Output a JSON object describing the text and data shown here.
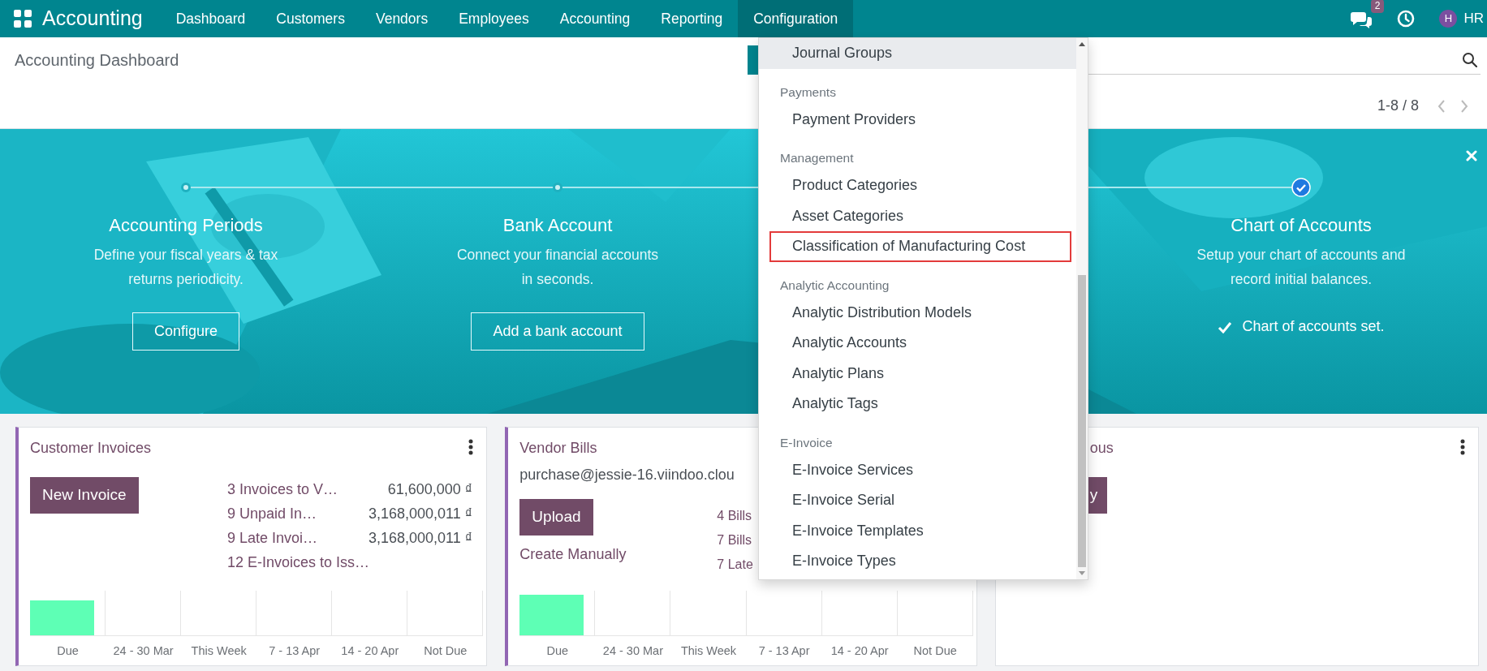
{
  "navbar": {
    "app_name": "Accounting",
    "menu": [
      {
        "label": "Dashboard",
        "selected": false
      },
      {
        "label": "Customers",
        "selected": false
      },
      {
        "label": "Vendors",
        "selected": false
      },
      {
        "label": "Employees",
        "selected": false
      },
      {
        "label": "Accounting",
        "selected": false
      },
      {
        "label": "Reporting",
        "selected": false
      },
      {
        "label": "Configuration",
        "selected": true
      }
    ],
    "messages_badge": "2",
    "avatar_initial": "H",
    "user": "HR"
  },
  "control_panel": {
    "breadcrumb": "Accounting Dashboard",
    "pager": "1-8 / 8"
  },
  "onboarding": {
    "steps": [
      {
        "title": "Accounting Periods",
        "description_lines": [
          "Define your fiscal years & tax",
          "returns periodicity."
        ],
        "done": false,
        "action": "Configure"
      },
      {
        "title": "Bank Account",
        "description_lines": [
          "Connect your financial accounts",
          "in seconds."
        ],
        "done": false,
        "action": "Add a bank account"
      },
      {
        "title": "Chart of Accounts",
        "description_lines": [
          "Setup your chart of accounts and",
          "record initial balances."
        ],
        "done": true,
        "action": "Chart of accounts set."
      }
    ]
  },
  "cards": [
    {
      "title": "Customer Invoices",
      "accent": true,
      "primary_action": "New Invoice",
      "stats": [
        {
          "label": "3 Invoices to V…",
          "amount": "61,600,000 ₫"
        },
        {
          "label": "9 Unpaid In…",
          "amount": "3,168,000,011 ₫"
        },
        {
          "label": "9 Late Invoi…",
          "amount": "3,168,000,011 ₫"
        },
        {
          "label": "12 E-Invoices to Iss…"
        }
      ],
      "chart": {
        "columns": [
          {
            "label": "Due",
            "filled": true
          },
          {
            "label": "24 - 30 Mar",
            "filled": false
          },
          {
            "label": "This Week",
            "filled": false
          },
          {
            "label": "7 - 13 Apr",
            "filled": false
          },
          {
            "label": "14 - 20 Apr",
            "filled": false
          },
          {
            "label": "Not Due",
            "filled": false
          }
        ]
      }
    },
    {
      "title": "Vendor Bills",
      "subtitle": "purchase@jessie-16.viindoo.clou",
      "accent": true,
      "primary_action": "Upload",
      "secondary_action": "Create Manually",
      "stats": [
        {
          "label": "4 Bills"
        },
        {
          "label": "7 Bills"
        },
        {
          "label": "7 Late"
        }
      ],
      "chart": {
        "columns": [
          {
            "label": "Due",
            "filled": true
          },
          {
            "label": "24 - 30 Mar",
            "filled": false
          },
          {
            "label": "This Week",
            "filled": false
          },
          {
            "label": "7 - 13 Apr",
            "filled": false
          },
          {
            "label": "14 - 20 Apr",
            "filled": false
          },
          {
            "label": "Not Due",
            "filled": false
          }
        ]
      }
    },
    {
      "title": "ous",
      "accent": false,
      "primary_action": "y"
    }
  ],
  "config_menu": {
    "sections": [
      {
        "items": [
          {
            "label": "Journal Groups",
            "hovered": true,
            "outlined": false
          }
        ]
      },
      {
        "header": "Payments",
        "items": [
          {
            "label": "Payment Providers",
            "hovered": false,
            "outlined": false
          }
        ]
      },
      {
        "header": "Management",
        "items": [
          {
            "label": "Product Categories",
            "hovered": false,
            "outlined": false
          },
          {
            "label": "Asset Categories",
            "hovered": false,
            "outlined": false
          },
          {
            "label": "Classification of Manufacturing Cost",
            "hovered": false,
            "outlined": true
          }
        ]
      },
      {
        "header": "Analytic Accounting",
        "items": [
          {
            "label": "Analytic Distribution Models",
            "hovered": false,
            "outlined": false
          },
          {
            "label": "Analytic Accounts",
            "hovered": false,
            "outlined": false
          },
          {
            "label": "Analytic Plans",
            "hovered": false,
            "outlined": false
          },
          {
            "label": "Analytic Tags",
            "hovered": false,
            "outlined": false
          }
        ]
      },
      {
        "header": "E-Invoice",
        "items": [
          {
            "label": "E-Invoice Services",
            "hovered": false,
            "outlined": false
          },
          {
            "label": "E-Invoice Serial",
            "hovered": false,
            "outlined": false
          },
          {
            "label": "E-Invoice Templates",
            "hovered": false,
            "outlined": false
          },
          {
            "label": "E-Invoice Types",
            "hovered": false,
            "outlined": false
          }
        ]
      }
    ]
  }
}
